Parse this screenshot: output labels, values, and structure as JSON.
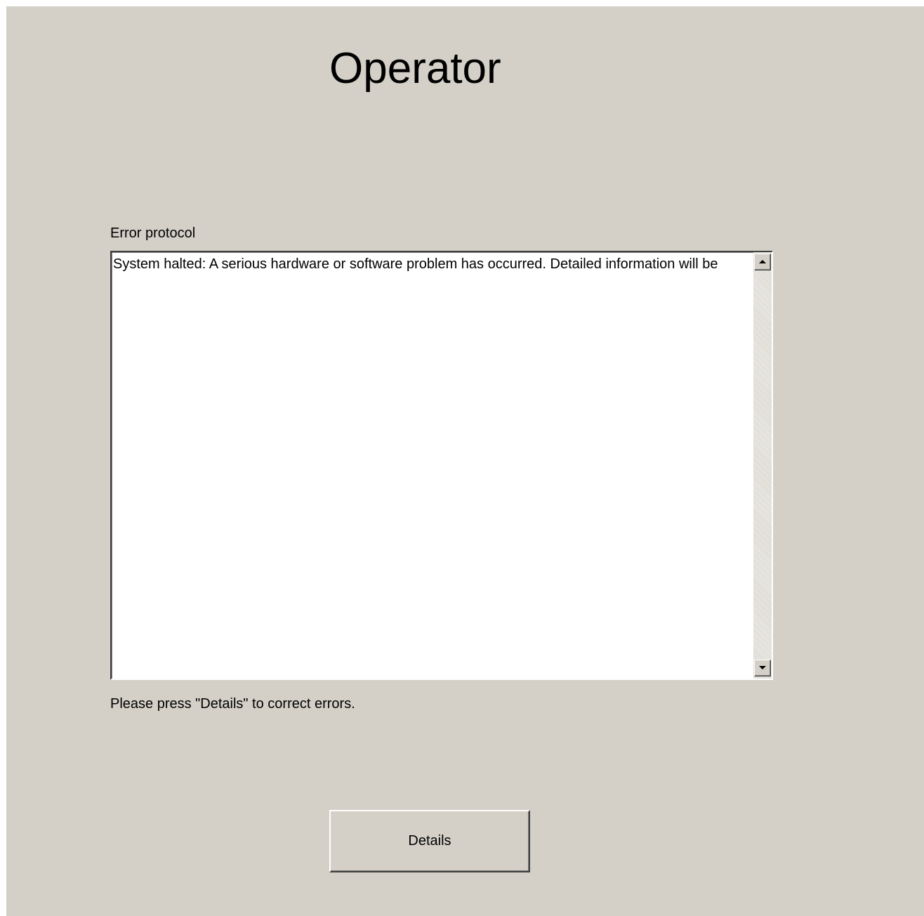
{
  "screen": {
    "title": "Operator",
    "error_protocol_label": "Error protocol",
    "error_protocol_text": "System halted: A serious hardware or software problem has occurred. Detailed information will be",
    "hint_text": "Please press \"Details\" to correct errors.",
    "details_button_label": "Details"
  },
  "colors": {
    "background": "#d4d0c8",
    "listbox_background": "#ffffff",
    "text": "#000000"
  },
  "icons": {
    "scroll_up": "scroll-up-arrow-icon",
    "scroll_down": "scroll-down-arrow-icon"
  }
}
